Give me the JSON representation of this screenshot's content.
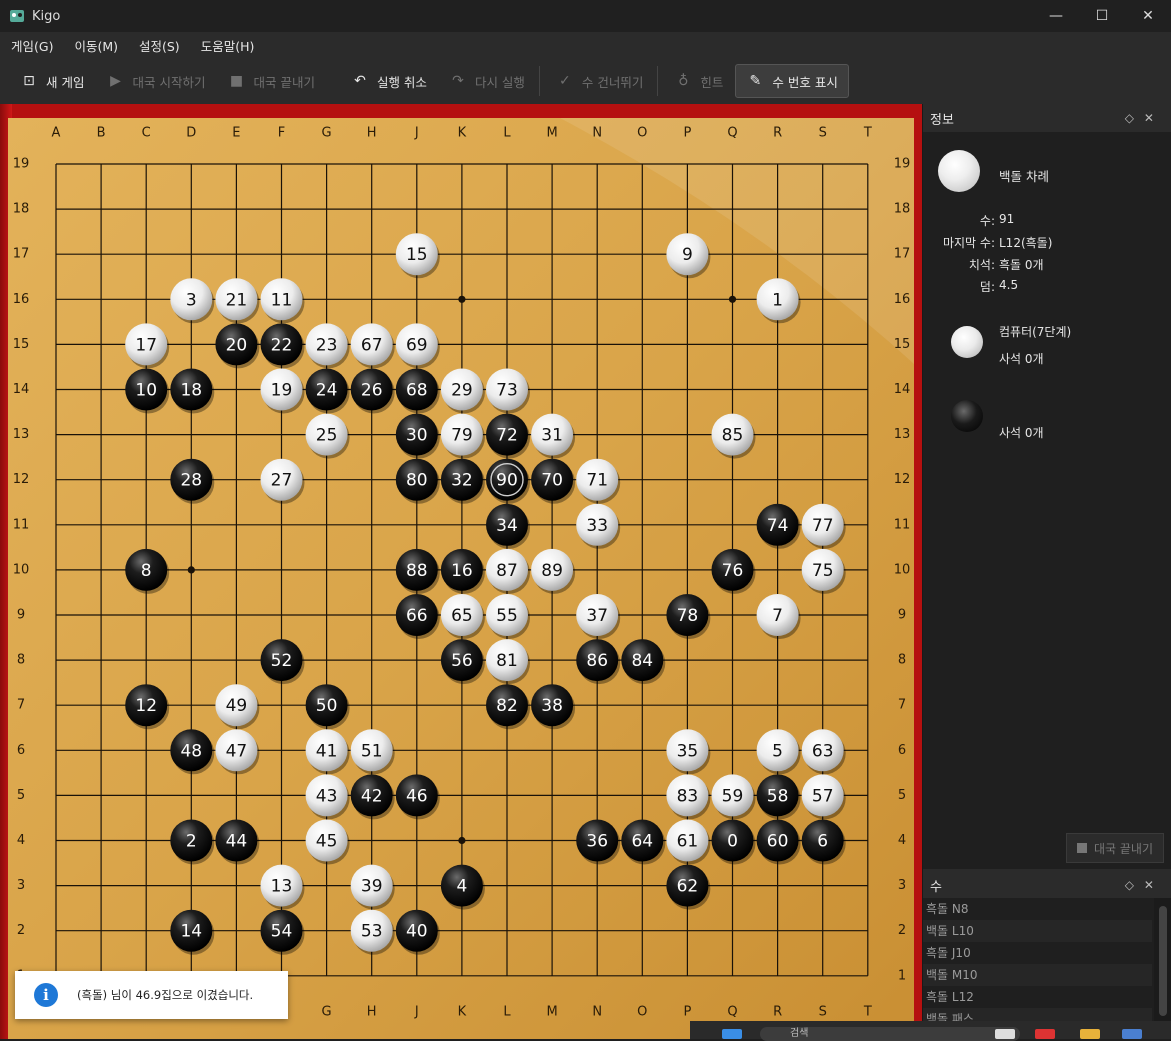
{
  "window": {
    "title": "Kigo",
    "minimize": "—",
    "maximize": "☐",
    "close": "✕"
  },
  "menu": [
    "게임(G)",
    "이동(M)",
    "설정(S)",
    "도움말(H)"
  ],
  "toolbar": [
    {
      "label": "새 게임",
      "icon": "new-game-icon",
      "glyph": "⊡",
      "state": "enabled"
    },
    {
      "label": "대국 시작하기",
      "icon": "play-icon",
      "glyph": "▶",
      "state": "disabled"
    },
    {
      "label": "대국 끝내기",
      "icon": "stop-icon",
      "glyph": "■",
      "state": "disabled"
    },
    {
      "label": "실행 취소",
      "icon": "undo-icon",
      "glyph": "↶",
      "state": "enabled"
    },
    {
      "label": "다시 실행",
      "icon": "redo-icon",
      "glyph": "↷",
      "state": "disabled"
    },
    {
      "label": "수 건너뛰기",
      "icon": "pass-icon",
      "glyph": "✓",
      "state": "disabled"
    },
    {
      "label": "힌트",
      "icon": "hint-icon",
      "glyph": "♁",
      "state": "disabled"
    },
    {
      "label": "수 번호 표시",
      "icon": "pin-icon",
      "glyph": "✎",
      "state": "active"
    }
  ],
  "board": {
    "size": 19,
    "columns": [
      "A",
      "B",
      "C",
      "D",
      "E",
      "F",
      "G",
      "H",
      "J",
      "K",
      "L",
      "M",
      "N",
      "O",
      "P",
      "Q",
      "R",
      "S",
      "T"
    ],
    "rows": [
      "19",
      "18",
      "17",
      "16",
      "15",
      "14",
      "13",
      "12",
      "11",
      "10",
      "9",
      "8",
      "7",
      "6",
      "5",
      "4",
      "3",
      "2",
      "1"
    ],
    "bottom_columns_visible": [
      "G",
      "H",
      "J",
      "K",
      "L",
      "M",
      "N",
      "O",
      "P",
      "Q",
      "R",
      "S",
      "T"
    ],
    "colors": {
      "wood": "#d9a449",
      "line": "#1a1208",
      "frame": "#b51010"
    },
    "stones": [
      {
        "move": 0,
        "color": "black",
        "point": "Q4"
      },
      {
        "move": 1,
        "color": "white",
        "point": "R16"
      },
      {
        "move": 2,
        "color": "black",
        "point": "D4"
      },
      {
        "move": 3,
        "color": "white",
        "point": "D16"
      },
      {
        "move": 4,
        "color": "black",
        "point": "K3"
      },
      {
        "move": 5,
        "color": "white",
        "point": "R6"
      },
      {
        "move": 6,
        "color": "black",
        "point": "S4"
      },
      {
        "move": 7,
        "color": "white",
        "point": "R9"
      },
      {
        "move": 8,
        "color": "black",
        "point": "C10"
      },
      {
        "move": 9,
        "color": "white",
        "point": "P17"
      },
      {
        "move": 10,
        "color": "black",
        "point": "C14"
      },
      {
        "move": 11,
        "color": "white",
        "point": "F16"
      },
      {
        "move": 12,
        "color": "black",
        "point": "C7"
      },
      {
        "move": 13,
        "color": "white",
        "point": "F3"
      },
      {
        "move": 14,
        "color": "black",
        "point": "D2"
      },
      {
        "move": 15,
        "color": "white",
        "point": "J17"
      },
      {
        "move": 16,
        "color": "black",
        "point": "K10"
      },
      {
        "move": 17,
        "color": "white",
        "point": "C15"
      },
      {
        "move": 18,
        "color": "black",
        "point": "D14"
      },
      {
        "move": 19,
        "color": "white",
        "point": "F14"
      },
      {
        "move": 20,
        "color": "black",
        "point": "E15"
      },
      {
        "move": 21,
        "color": "white",
        "point": "E16"
      },
      {
        "move": 22,
        "color": "black",
        "point": "F15"
      },
      {
        "move": 23,
        "color": "white",
        "point": "G15"
      },
      {
        "move": 24,
        "color": "black",
        "point": "G14"
      },
      {
        "move": 25,
        "color": "white",
        "point": "G13"
      },
      {
        "move": 26,
        "color": "black",
        "point": "H14"
      },
      {
        "move": 27,
        "color": "white",
        "point": "F12"
      },
      {
        "move": 28,
        "color": "black",
        "point": "D12"
      },
      {
        "move": 29,
        "color": "white",
        "point": "K14"
      },
      {
        "move": 30,
        "color": "black",
        "point": "J13"
      },
      {
        "move": 31,
        "color": "white",
        "point": "M13"
      },
      {
        "move": 32,
        "color": "black",
        "point": "K12"
      },
      {
        "move": 33,
        "color": "white",
        "point": "N11"
      },
      {
        "move": 34,
        "color": "black",
        "point": "L11"
      },
      {
        "move": 35,
        "color": "white",
        "point": "P6"
      },
      {
        "move": 36,
        "color": "black",
        "point": "N4"
      },
      {
        "move": 37,
        "color": "white",
        "point": "N9"
      },
      {
        "move": 38,
        "color": "black",
        "point": "M7"
      },
      {
        "move": 39,
        "color": "white",
        "point": "H3"
      },
      {
        "move": 40,
        "color": "black",
        "point": "J2"
      },
      {
        "move": 41,
        "color": "white",
        "point": "G6"
      },
      {
        "move": 42,
        "color": "black",
        "point": "H5"
      },
      {
        "move": 43,
        "color": "white",
        "point": "G5"
      },
      {
        "move": 44,
        "color": "black",
        "point": "E4"
      },
      {
        "move": 45,
        "color": "white",
        "point": "G4"
      },
      {
        "move": 46,
        "color": "black",
        "point": "J5"
      },
      {
        "move": 47,
        "color": "white",
        "point": "E6"
      },
      {
        "move": 48,
        "color": "black",
        "point": "D6"
      },
      {
        "move": 49,
        "color": "white",
        "point": "E7"
      },
      {
        "move": 50,
        "color": "black",
        "point": "G7"
      },
      {
        "move": 51,
        "color": "white",
        "point": "H6"
      },
      {
        "move": 52,
        "color": "black",
        "point": "F8"
      },
      {
        "move": 53,
        "color": "white",
        "point": "H2"
      },
      {
        "move": 54,
        "color": "black",
        "point": "F2"
      },
      {
        "move": 55,
        "color": "white",
        "point": "L9"
      },
      {
        "move": 56,
        "color": "black",
        "point": "K8"
      },
      {
        "move": 57,
        "color": "white",
        "point": "S5"
      },
      {
        "move": 58,
        "color": "black",
        "point": "R5"
      },
      {
        "move": 59,
        "color": "white",
        "point": "Q5"
      },
      {
        "move": 60,
        "color": "black",
        "point": "R4"
      },
      {
        "move": 61,
        "color": "white",
        "point": "P4"
      },
      {
        "move": 62,
        "color": "black",
        "point": "P3"
      },
      {
        "move": 63,
        "color": "white",
        "point": "S6"
      },
      {
        "move": 64,
        "color": "black",
        "point": "O4"
      },
      {
        "move": 65,
        "color": "white",
        "point": "K9"
      },
      {
        "move": 66,
        "color": "black",
        "point": "J9"
      },
      {
        "move": 67,
        "color": "white",
        "point": "H15"
      },
      {
        "move": 68,
        "color": "black",
        "point": "J14"
      },
      {
        "move": 69,
        "color": "white",
        "point": "J15"
      },
      {
        "move": 70,
        "color": "black",
        "point": "M12"
      },
      {
        "move": 71,
        "color": "white",
        "point": "N12"
      },
      {
        "move": 72,
        "color": "black",
        "point": "L13"
      },
      {
        "move": 73,
        "color": "white",
        "point": "L14"
      },
      {
        "move": 74,
        "color": "black",
        "point": "R11"
      },
      {
        "move": 75,
        "color": "white",
        "point": "S10"
      },
      {
        "move": 76,
        "color": "black",
        "point": "Q10"
      },
      {
        "move": 77,
        "color": "white",
        "point": "S11"
      },
      {
        "move": 78,
        "color": "black",
        "point": "P9"
      },
      {
        "move": 79,
        "color": "white",
        "point": "K13"
      },
      {
        "move": 80,
        "color": "black",
        "point": "J12"
      },
      {
        "move": 81,
        "color": "white",
        "point": "L8"
      },
      {
        "move": 82,
        "color": "black",
        "point": "L7"
      },
      {
        "move": 83,
        "color": "white",
        "point": "P5"
      },
      {
        "move": 84,
        "color": "black",
        "point": "O8"
      },
      {
        "move": 85,
        "color": "white",
        "point": "Q13"
      },
      {
        "move": 86,
        "color": "black",
        "point": "N8"
      },
      {
        "move": 87,
        "color": "white",
        "point": "L10"
      },
      {
        "move": 88,
        "color": "black",
        "point": "J10"
      },
      {
        "move": 89,
        "color": "white",
        "point": "M10"
      },
      {
        "move": 90,
        "color": "black",
        "point": "L12",
        "last": true
      }
    ]
  },
  "info_panel": {
    "title": "정보",
    "turn_label": "백돌 차례",
    "rows": [
      {
        "key": "수:",
        "value": "91"
      },
      {
        "key": "마지막 수:",
        "value": "L12(흑돌)"
      },
      {
        "key": "치석:",
        "value": "흑돌 0개"
      },
      {
        "key": "덤:",
        "value": "4.5"
      }
    ],
    "white_player": {
      "name": "컴퓨터(7단계)",
      "captures": "사석 0개"
    },
    "black_player": {
      "name": "",
      "captures": "사석 0개"
    },
    "end_game_button": "대국 끝내기"
  },
  "moves_panel": {
    "title": "수",
    "items": [
      "흑돌 N8",
      "백돌 L10",
      "흑돌 J10",
      "백돌 M10",
      "흑돌 L12",
      "백돌 패스"
    ]
  },
  "toast": {
    "message": "(흑돌) 님이 46.9집으로 이겼습니다."
  },
  "taskbar": {
    "search_placeholder": "검색"
  }
}
